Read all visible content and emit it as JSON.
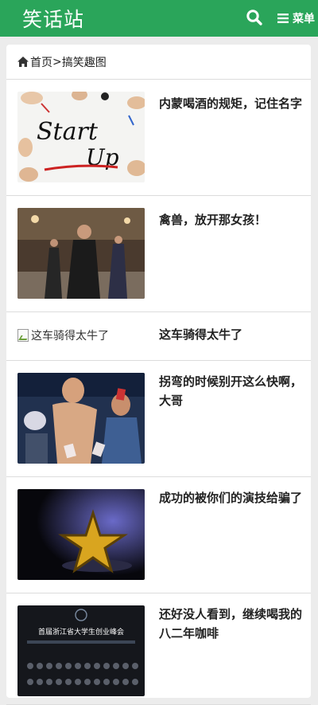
{
  "header": {
    "logo": "笑话站",
    "menu_label": "菜单",
    "brand_color": "#2aa55a"
  },
  "breadcrumb": {
    "home": "首页",
    "separator": ">",
    "current": "搞笑趣图"
  },
  "items": [
    {
      "title": "内蒙喝酒的规矩，记住名字",
      "image": "start-up-whiteboard-photo",
      "image_text": [
        "Start",
        "Up"
      ]
    },
    {
      "title": "禽兽，放开那女孩！",
      "image": "man-in-black-coat-hall-photo"
    },
    {
      "title": "这车骑得太牛了",
      "image_alt": "这车骑得太牛了",
      "image_broken": true
    },
    {
      "title": "拐弯的时候别开这么快啊，大哥",
      "image": "cards-party-photo"
    },
    {
      "title": "成功的被你们的演技给骗了",
      "image": "gold-star-stage-photo"
    },
    {
      "title": "还好没人看到，继续喝我的八二年咖啡",
      "image": "entrepreneurship-summit-poster",
      "image_text": [
        "首届浙江省大学生创业峰会"
      ]
    }
  ]
}
